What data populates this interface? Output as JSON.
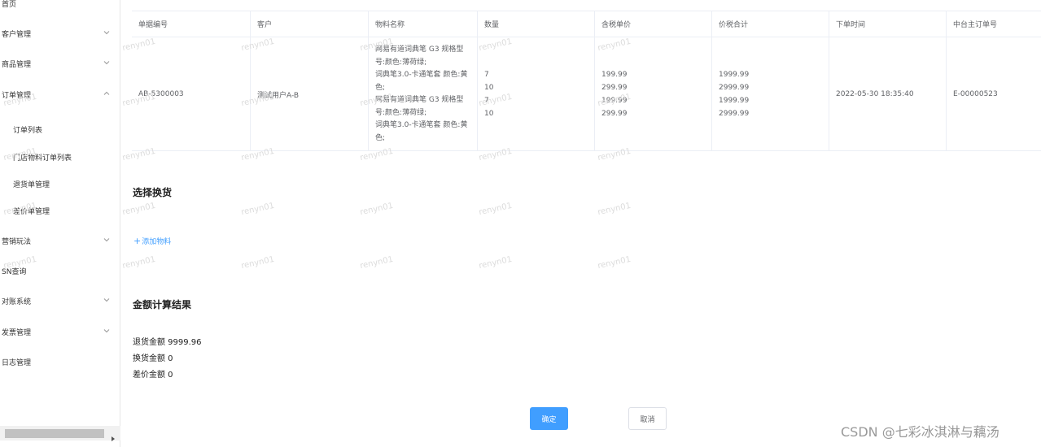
{
  "sidebar": {
    "items": [
      {
        "label": "首页",
        "expandable": false
      },
      {
        "label": "客户管理",
        "expandable": true
      },
      {
        "label": "商品管理",
        "expandable": true
      },
      {
        "label": "订单管理",
        "expandable": true,
        "expanded": true
      },
      {
        "label": "订单列表",
        "sub": true
      },
      {
        "label": "门店物料订单列表",
        "sub": true
      },
      {
        "label": "退货单管理",
        "sub": true
      },
      {
        "label": "差价单管理",
        "sub": true
      },
      {
        "label": "营销玩法",
        "expandable": true
      },
      {
        "label": "SN查询",
        "expandable": false
      },
      {
        "label": "对账系统",
        "expandable": true
      },
      {
        "label": "发票管理",
        "expandable": true
      },
      {
        "label": "日志管理",
        "expandable": false
      }
    ]
  },
  "table": {
    "headers": [
      "单据编号",
      "客户",
      "物料名称",
      "数量",
      "含税单价",
      "价税合计",
      "下单时间",
      "中台主订单号"
    ],
    "row": {
      "doc_no": "AB-5300003",
      "customer": "测试用户A-B",
      "materials": [
        "网易有道词典笔 G3 规格型",
        "号:颜色:薄荷绿;",
        "词典笔3.0-卡通笔套 颜色:黄",
        "色;",
        "网易有道词典笔 G3 规格型",
        "号:颜色:薄荷绿;",
        "词典笔3.0-卡通笔套 颜色:黄",
        "色;"
      ],
      "quantities": [
        "7",
        "10",
        "7",
        "10"
      ],
      "unit_prices": [
        "199.99",
        "299.99",
        "199.99",
        "299.99"
      ],
      "totals": [
        "1999.99",
        "2999.99",
        "1999.99",
        "2999.99"
      ],
      "order_time": "2022-05-30 18:35:40",
      "main_order_no": "E-00000523"
    }
  },
  "exchange": {
    "title": "选择换货",
    "add_label": "添加物料",
    "add_icon": "plus-icon"
  },
  "result": {
    "title": "金额计算结果",
    "return_amount": "退货金额 9999.96",
    "exchange_amount": "换货金额 0",
    "diff_amount": "差价金额 0"
  },
  "actions": {
    "confirm_label": "确定",
    "cancel_label": "取消"
  },
  "watermark": {
    "text": "renyn01",
    "credit": "CSDN @七彩冰淇淋与藕汤"
  },
  "colors": {
    "primary": "#409eff",
    "border": "#ebeef5",
    "text": "#606266"
  }
}
